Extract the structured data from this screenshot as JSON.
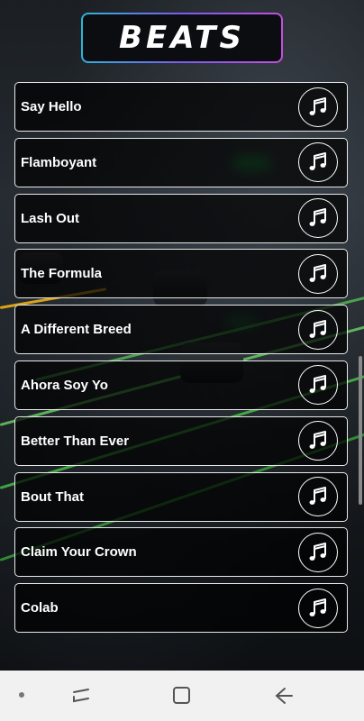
{
  "app": {
    "logo_text": "BEATS"
  },
  "tracks": [
    {
      "title": "Say Hello"
    },
    {
      "title": "Flamboyant"
    },
    {
      "title": "Lash Out"
    },
    {
      "title": "The Formula"
    },
    {
      "title": "A Different Breed"
    },
    {
      "title": "Ahora Soy Yo"
    },
    {
      "title": "Better Than Ever"
    },
    {
      "title": "Bout That"
    },
    {
      "title": "Claim Your Crown"
    },
    {
      "title": "Colab"
    }
  ],
  "icons": {
    "track_icon": "music-note-icon",
    "nav_recents": "recents-icon",
    "nav_home": "home-icon",
    "nav_back": "back-icon"
  },
  "colors": {
    "logo_border_start": "#2fb3d9",
    "logo_border_end": "#c34fe0",
    "item_border": "#e9e9e9",
    "accent_glow": "#1ec84a"
  }
}
